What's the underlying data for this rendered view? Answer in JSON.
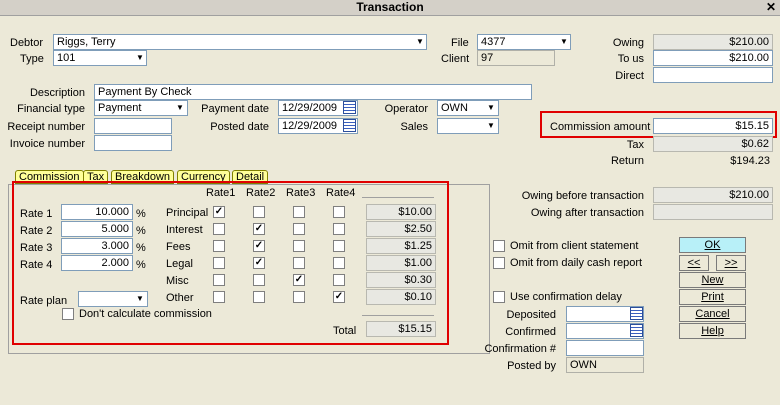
{
  "window": {
    "title": "Transaction",
    "close": "✕"
  },
  "debtor": {
    "label": "Debtor",
    "value": "Riggs, Terry"
  },
  "type": {
    "label": "Type",
    "value": "101"
  },
  "file": {
    "label": "File",
    "value": "4377"
  },
  "client": {
    "label": "Client",
    "value": "97"
  },
  "owing": {
    "label": "Owing",
    "value": "$210.00"
  },
  "to_us": {
    "label": "To us",
    "value": "$210.00"
  },
  "direct": {
    "label": "Direct",
    "value": ""
  },
  "description": {
    "label": "Description",
    "value": "Payment By Check"
  },
  "financial_type": {
    "label": "Financial type",
    "value": "Payment"
  },
  "payment_date": {
    "label": "Payment date",
    "value": "12/29/2009"
  },
  "posted_date": {
    "label": "Posted date",
    "value": "12/29/2009"
  },
  "operator": {
    "label": "Operator",
    "value": "OWN"
  },
  "sales": {
    "label": "Sales",
    "value": ""
  },
  "receipt_number": {
    "label": "Receipt number",
    "value": ""
  },
  "invoice_number": {
    "label": "Invoice number",
    "value": ""
  },
  "commission_amount": {
    "label": "Commission amount",
    "value": "$15.15"
  },
  "tax": {
    "label": "Tax",
    "value": "$0.62"
  },
  "return": {
    "label": "Return",
    "value": "$194.23"
  },
  "tabs": [
    "Commission",
    "Tax",
    "Breakdown",
    "Currency",
    "Detail"
  ],
  "rates": [
    {
      "label": "Rate 1",
      "value": "10.000",
      "unit": "%"
    },
    {
      "label": "Rate 2",
      "value": "5.000",
      "unit": "%"
    },
    {
      "label": "Rate 3",
      "value": "3.000",
      "unit": "%"
    },
    {
      "label": "Rate 4",
      "value": "2.000",
      "unit": "%"
    }
  ],
  "rate_plan": {
    "label": "Rate plan",
    "value": ""
  },
  "dont_calc": {
    "label": "Don't calculate commission",
    "checked": false
  },
  "rate_headers": [
    "Rate1",
    "Rate2",
    "Rate3",
    "Rate4"
  ],
  "grid_rows": [
    {
      "label": "Principal",
      "checks": [
        true,
        false,
        false,
        false
      ],
      "amount": "$10.00"
    },
    {
      "label": "Interest",
      "checks": [
        false,
        true,
        false,
        false
      ],
      "amount": "$2.50"
    },
    {
      "label": "Fees",
      "checks": [
        false,
        true,
        false,
        false
      ],
      "amount": "$1.25"
    },
    {
      "label": "Legal",
      "checks": [
        false,
        true,
        false,
        false
      ],
      "amount": "$1.00"
    },
    {
      "label": "Misc",
      "checks": [
        false,
        false,
        true,
        false
      ],
      "amount": "$0.30"
    },
    {
      "label": "Other",
      "checks": [
        false,
        false,
        false,
        true
      ],
      "amount": "$0.10"
    }
  ],
  "total": {
    "label": "Total",
    "value": "$15.15"
  },
  "owing_before": {
    "label": "Owing before transaction",
    "value": "$210.00"
  },
  "owing_after": {
    "label": "Owing after transaction",
    "value": ""
  },
  "omit_client": {
    "label": "Omit from client statement",
    "checked": false
  },
  "omit_daily": {
    "label": "Omit from daily cash report",
    "checked": false
  },
  "use_conf": {
    "label": "Use confirmation delay",
    "checked": false
  },
  "deposited": {
    "label": "Deposited",
    "value": ""
  },
  "confirmed": {
    "label": "Confirmed",
    "value": ""
  },
  "confirmation_no": {
    "label": "Confirmation #",
    "value": ""
  },
  "posted_by": {
    "label": "Posted by",
    "value": "OWN"
  },
  "buttons": {
    "ok": "OK",
    "prev": "<<",
    "next": ">>",
    "new": "New",
    "print": "Print",
    "cancel": "Cancel",
    "help": "Help"
  },
  "colors": {
    "highlight": "#e00000",
    "ok_button": "#b8f0f8",
    "tab": "#ffff99"
  }
}
